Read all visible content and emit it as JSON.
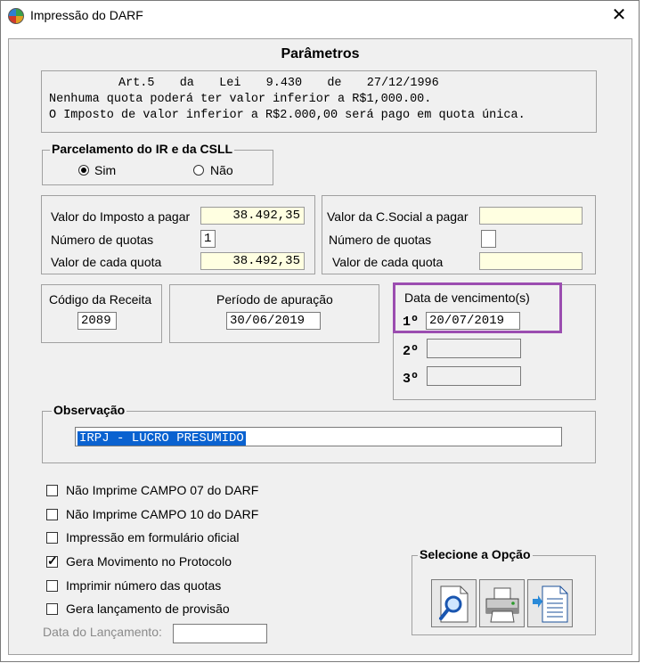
{
  "window": {
    "title": "Impressão do DARF",
    "close_glyph": "✕"
  },
  "header": "Parâmetros",
  "law": {
    "line1": "Art.5  da  Lei  9.430  de  27/12/1996",
    "line2": "Nenhuma quota poderá ter valor inferior a R$1,000.00.",
    "line3": "O Imposto de valor inferior a R$2.000,00 será pago em quota única."
  },
  "parcelamento": {
    "title": "Parcelamento do IR e da CSLL",
    "sim": "Sim",
    "nao": "Não",
    "selected": "Sim"
  },
  "imposto": {
    "valor_label": "Valor do Imposto a pagar",
    "valor": "38.492,35",
    "quotas_label": "Número de quotas",
    "quotas": "1",
    "cada_label": "Valor de cada quota",
    "cada": "38.492,35"
  },
  "csocial": {
    "valor_label": "Valor da C.Social a pagar",
    "valor": "",
    "quotas_label": "Número de quotas",
    "quotas": "",
    "cada_label": "Valor de cada quota",
    "cada": ""
  },
  "codigo": {
    "label": "Código da Receita",
    "value": "2089"
  },
  "periodo": {
    "label": "Período de apuração",
    "value": "30/06/2019"
  },
  "vencimento": {
    "label": "Data de vencimento(s)",
    "ord1": "1º",
    "date1": "20/07/2019",
    "ord2": "2º",
    "ord3": "3º"
  },
  "observacao": {
    "title": "Observação",
    "value": "IRPJ - LUCRO PRESUMIDO"
  },
  "options": [
    {
      "label": "Não Imprime CAMPO 07 do DARF",
      "checked": false
    },
    {
      "label": "Não Imprime CAMPO 10 do DARF",
      "checked": false
    },
    {
      "label": "Impressão em formulário oficial",
      "checked": false
    },
    {
      "label": "Gera Movimento no Protocolo",
      "checked": true
    },
    {
      "label": "Imprimir número das quotas",
      "checked": false
    },
    {
      "label": "Gera lançamento de provisão",
      "checked": false
    }
  ],
  "lancamento": {
    "label": "Data do Lançamento:",
    "value": ""
  },
  "selecione": {
    "title": "Selecione a Opção",
    "buttons": [
      "preview-icon",
      "printer-icon",
      "export-file-icon"
    ]
  },
  "colors": {
    "highlight": "#9b4db0",
    "yellow_field": "#ffffe1",
    "selection": "#0a62d0"
  }
}
